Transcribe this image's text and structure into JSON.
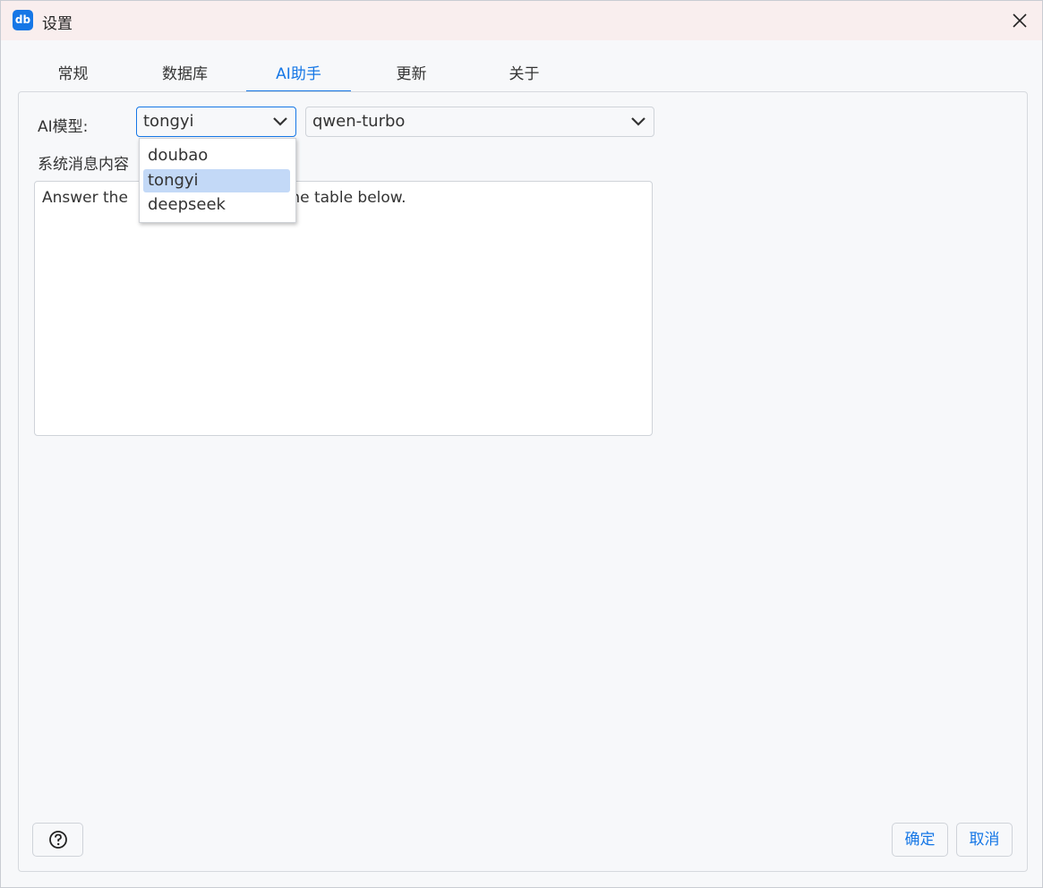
{
  "window": {
    "title": "设置",
    "logo_text": "db"
  },
  "tabs": [
    {
      "label": "常规"
    },
    {
      "label": "数据库"
    },
    {
      "label": "AI助手"
    },
    {
      "label": "更新"
    },
    {
      "label": "关于"
    }
  ],
  "active_tab": "AI助手",
  "ai": {
    "model_label": "AI模型:",
    "provider_value": "tongyi",
    "model_value": "qwen-turbo",
    "system_message_label": "系统消息内容",
    "system_message_visible_start": "Answer the ",
    "system_message_visible_end": "he table below."
  },
  "dropdown": {
    "options": [
      "doubao",
      "tongyi",
      "deepseek"
    ],
    "selected": "tongyi"
  },
  "footer": {
    "confirm_label": "确定",
    "cancel_label": "取消"
  },
  "colors": {
    "accent": "#1677e6",
    "titlebar_bg": "#f9eeee",
    "selected_option_bg": "#c3d9f7"
  },
  "icons": {
    "close": "close-icon",
    "chevron": "chevron-down-icon",
    "help": "help-icon"
  }
}
